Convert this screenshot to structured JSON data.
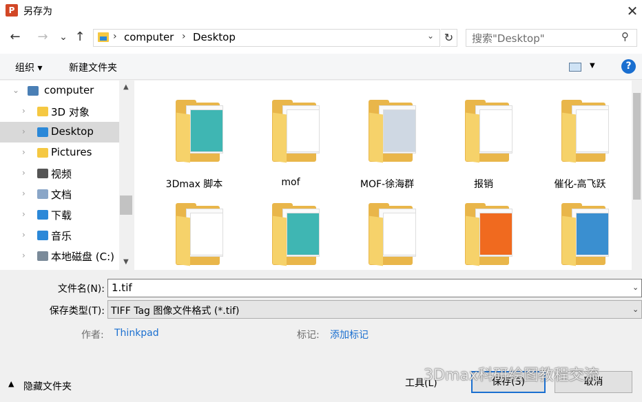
{
  "window": {
    "title": "另存为",
    "app_icon_letter": "P",
    "close": "✕"
  },
  "nav": {
    "back": "←",
    "forward": "→",
    "recent": "⌄",
    "up": "↑",
    "breadcrumb": [
      "computer",
      "Desktop"
    ],
    "refresh": "↻",
    "search_placeholder": "搜索\"Desktop\""
  },
  "toolbar": {
    "organize": "组织 ▾",
    "new_folder": "新建文件夹",
    "help": "?"
  },
  "sidebar": {
    "items": [
      {
        "label": "computer",
        "icon": "computer-icon",
        "expanded": true
      },
      {
        "label": "3D 对象",
        "icon": "3d-objects-icon"
      },
      {
        "label": "Desktop",
        "icon": "desktop-icon",
        "selected": true
      },
      {
        "label": "Pictures",
        "icon": "pictures-icon"
      },
      {
        "label": "视频",
        "icon": "videos-icon"
      },
      {
        "label": "文档",
        "icon": "documents-icon"
      },
      {
        "label": "下载",
        "icon": "downloads-icon"
      },
      {
        "label": "音乐",
        "icon": "music-icon"
      },
      {
        "label": "本地磁盘 (C:)",
        "icon": "local-disk-icon"
      }
    ]
  },
  "files": [
    {
      "label": "3Dmax 脚本",
      "icon": "folder-icon"
    },
    {
      "label": "mof",
      "icon": "folder-icon"
    },
    {
      "label": "MOF-徐海群",
      "icon": "folder-icon"
    },
    {
      "label": "报销",
      "icon": "folder-icon"
    },
    {
      "label": "催化-高飞跃",
      "icon": "folder-icon"
    },
    {
      "label": "",
      "icon": "folder-icon"
    },
    {
      "label": "",
      "icon": "folder-icon"
    },
    {
      "label": "",
      "icon": "folder-icon"
    },
    {
      "label": "",
      "icon": "folder-icon"
    },
    {
      "label": "",
      "icon": "folder-icon"
    }
  ],
  "form": {
    "filename_label": "文件名(N):",
    "filename_value": "1.tif",
    "filetype_label": "保存类型(T):",
    "filetype_value": "TIFF Tag 图像文件格式 (*.tif)",
    "author_label": "作者:",
    "author_value": "Thinkpad",
    "tags_label": "标记:",
    "tags_value": "添加标记"
  },
  "footer": {
    "hide_folders": "隐藏文件夹",
    "tools": "工具(L)",
    "save": "保存(S)",
    "cancel": "取消",
    "watermark": "3Dmax科研绘图教程交流"
  },
  "colors": {
    "accent": "#1a6fd0",
    "folder": "#f8d775",
    "selected": "#d9d9d9"
  }
}
